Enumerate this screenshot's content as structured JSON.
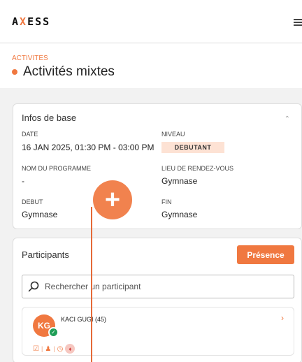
{
  "topbar": {
    "logo_a": "A",
    "logo_x": "X",
    "logo_rest": "ESS",
    "menu_icon": "hamburger-menu-icon"
  },
  "header": {
    "breadcrumb": "ACTIVITES",
    "title": "Activités mixtes"
  },
  "basic_info": {
    "title": "Infos de base",
    "date_label": "DATE",
    "date_value": "16 JAN 2025, 01:30 PM - 03:00 PM",
    "level_label": "NIVEAU",
    "level_value": "DEBUTANT",
    "program_label": "NOM DU PROGRAMME",
    "program_value": "-",
    "meeting_label": "LIEU DE RENDEZ-VOUS",
    "meeting_value": "Gymnase",
    "start_label": "DEBUT",
    "start_value": "Gymnase",
    "end_label": "FIN",
    "end_value": "Gymnase"
  },
  "participants": {
    "title": "Participants",
    "presence_label": "Présence",
    "search_placeholder": "Rechercher un participant",
    "items": [
      {
        "initials": "KG",
        "name": "KACI GUGI (45)",
        "status": "present"
      }
    ]
  },
  "colors": {
    "accent": "#f07840",
    "success": "#1e9e57",
    "badge_bg": "#fde2d4"
  }
}
